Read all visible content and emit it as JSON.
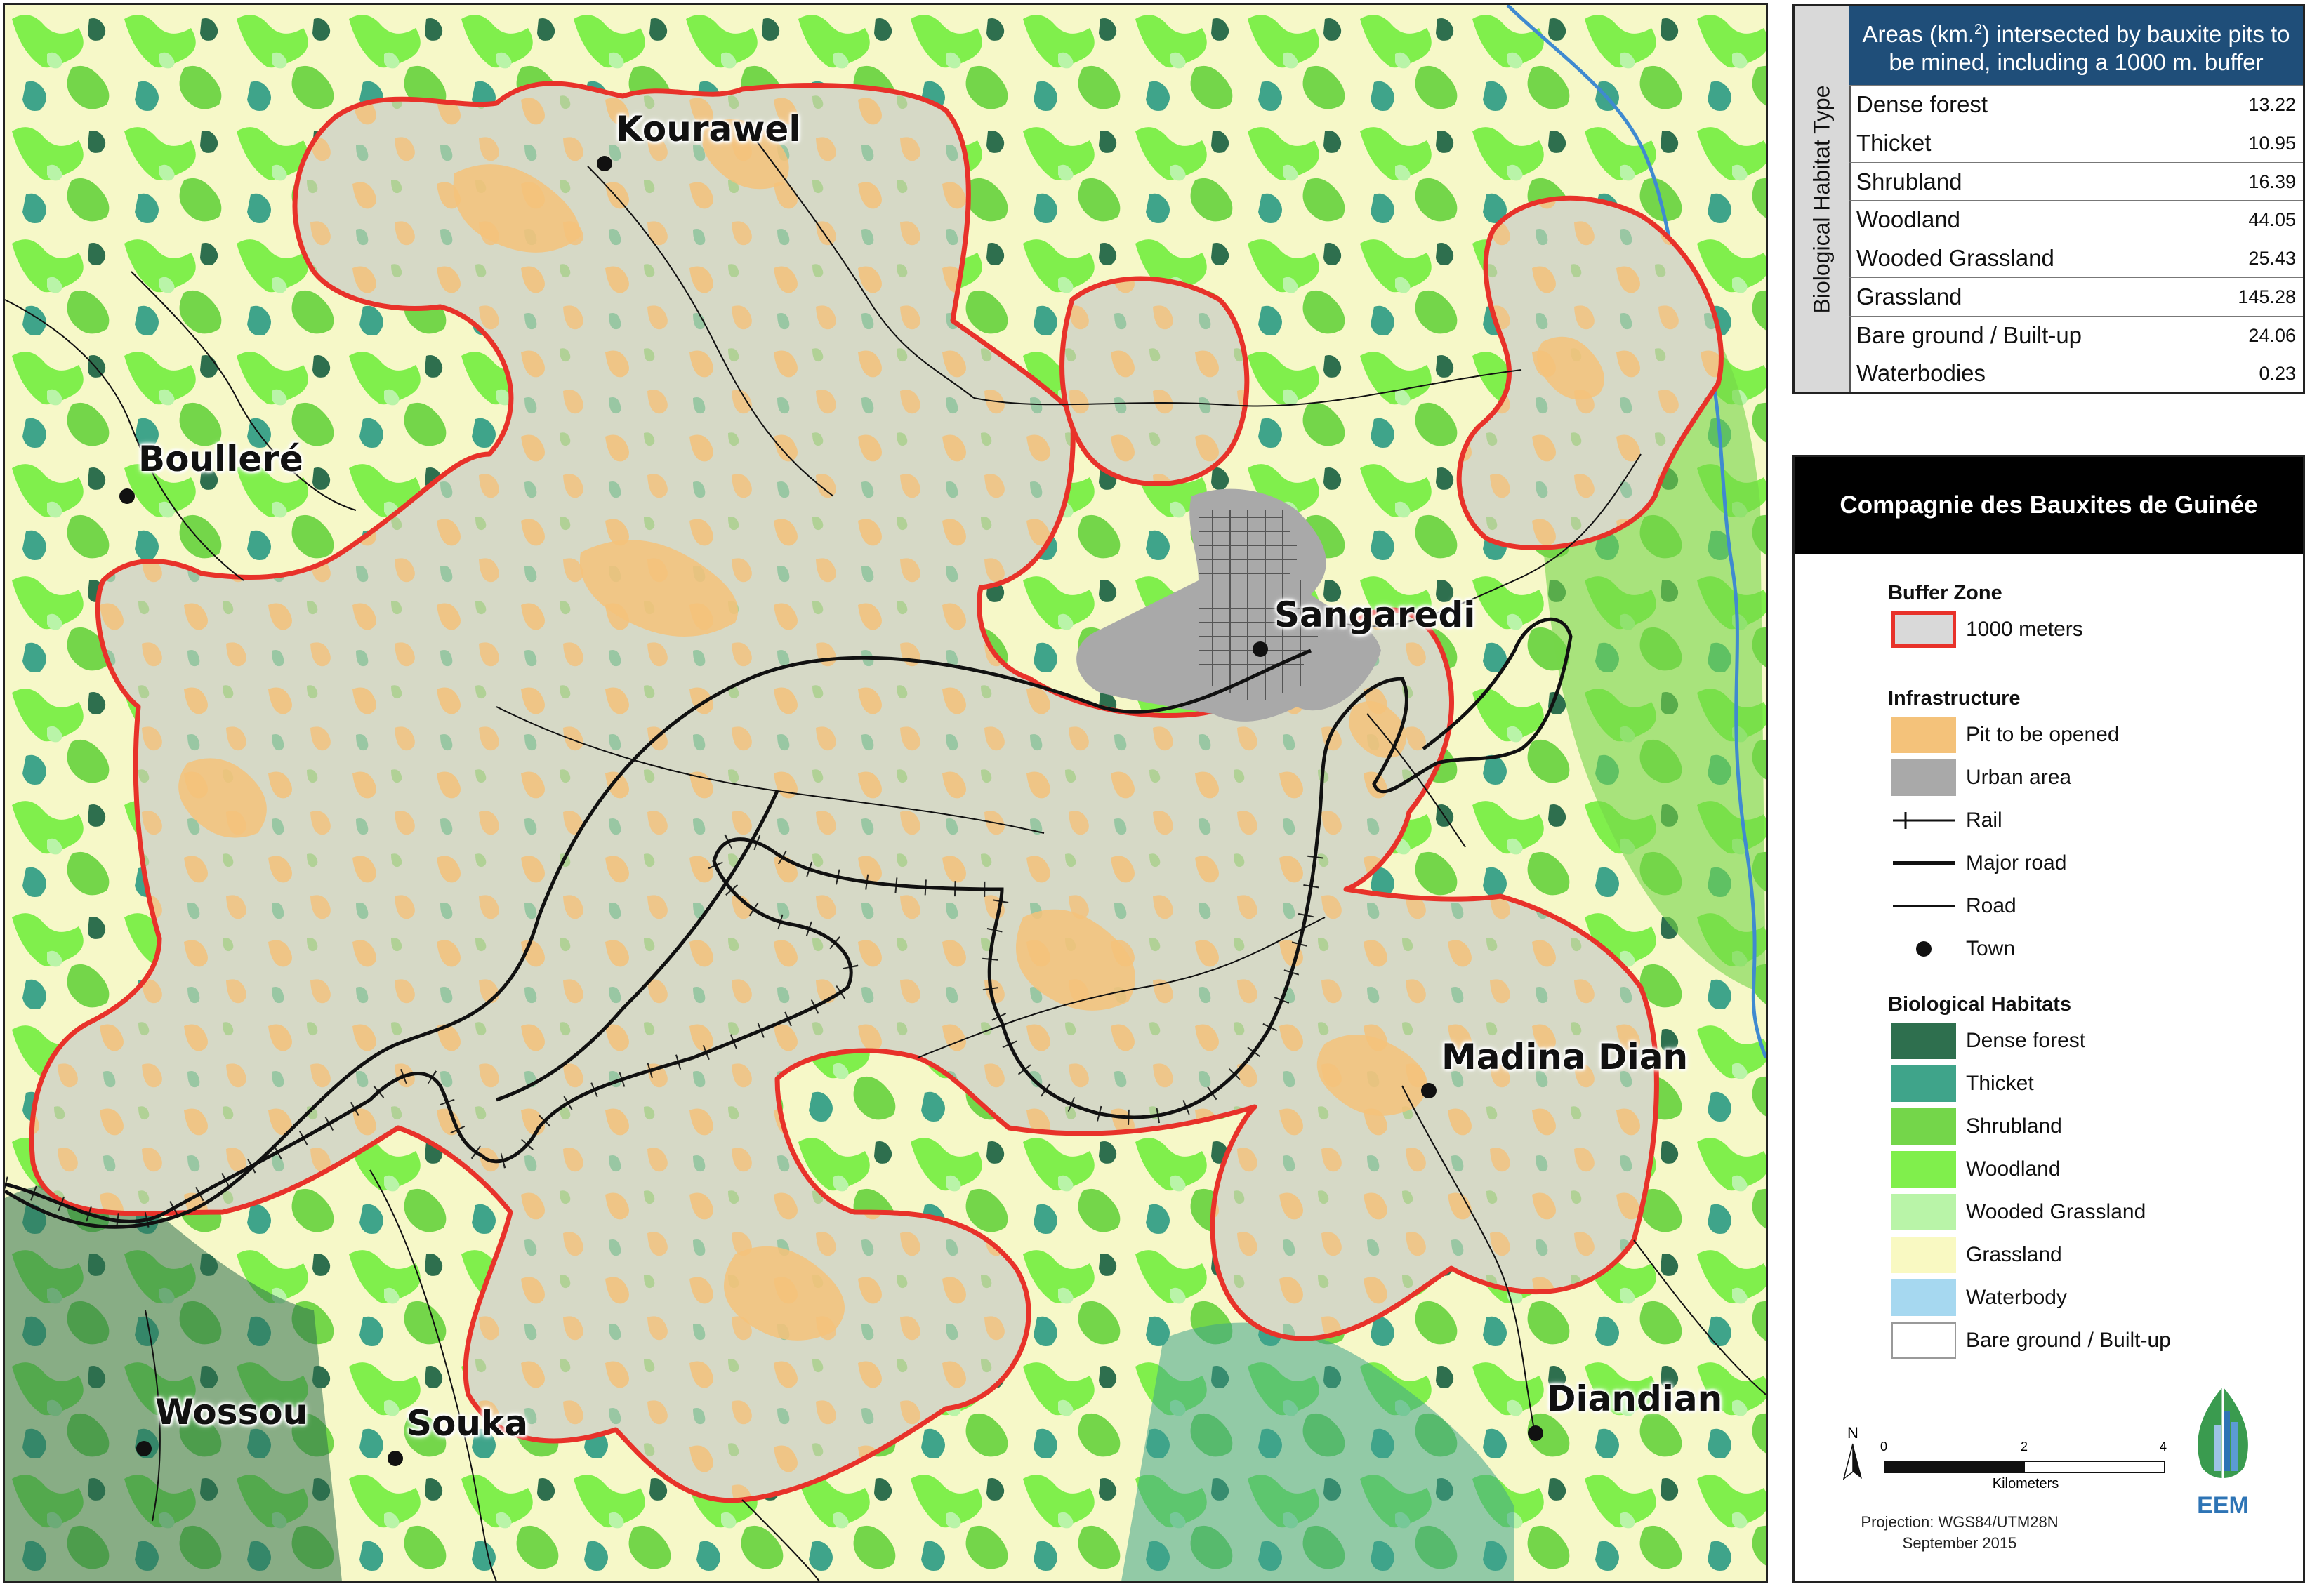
{
  "map": {
    "towns": [
      {
        "name": "Kourawel"
      },
      {
        "name": "Boulleré"
      },
      {
        "name": "Sangaredi"
      },
      {
        "name": "Madina Dian"
      },
      {
        "name": "Wossou"
      },
      {
        "name": "Souka"
      },
      {
        "name": "Diandian"
      }
    ],
    "colors": {
      "buffer_outline": "#e8322a",
      "buffer_fill": "#d8d8c8",
      "pit": "#f4c27a",
      "urban": "#a9a9a9",
      "dense_forest": "#2e6f4e",
      "thicket": "#3fa48a",
      "shrubland": "#74d64a",
      "woodland": "#80ef4c",
      "wooded_grassland": "#b9f4a8",
      "grassland": "#f9f9c2",
      "waterbody": "#a6d8f0",
      "bare": "#ffffff"
    }
  },
  "table": {
    "side_label": "Biological Habitat Type",
    "header_line1": "Areas (km.",
    "header_sup": "2",
    "header_line2": ") intersected by bauxite pits to be mined, including a 1000 m. buffer",
    "rows": [
      {
        "name": "Dense forest",
        "value": "13.22"
      },
      {
        "name": "Thicket",
        "value": "10.95"
      },
      {
        "name": "Shrubland",
        "value": "16.39"
      },
      {
        "name": "Woodland",
        "value": "44.05"
      },
      {
        "name": "Wooded Grassland",
        "value": "25.43"
      },
      {
        "name": "Grassland",
        "value": "145.28"
      },
      {
        "name": "Bare ground / Built-up",
        "value": "24.06"
      },
      {
        "name": "Waterbodies",
        "value": "0.23"
      }
    ]
  },
  "legend": {
    "title": "Compagnie des Bauxites de Guinée",
    "buffer_zone": {
      "heading": "Buffer Zone",
      "label": "1000 meters"
    },
    "infrastructure": {
      "heading": "Infrastructure",
      "pit": "Pit to be opened",
      "urban": "Urban area",
      "rail": "Rail",
      "major_road": "Major road",
      "road": "Road",
      "town": "Town"
    },
    "habitats": {
      "heading": "Biological Habitats",
      "items": [
        "Dense forest",
        "Thicket",
        "Shrubland",
        "Woodland",
        "Wooded Grassland",
        "Grassland",
        "Waterbody",
        "Bare ground / Built-up"
      ]
    },
    "north": "N",
    "scale": {
      "ticks": [
        "0",
        "2",
        "4"
      ],
      "unit": "Kilometers"
    },
    "projection": "Projection: WGS84/UTM28N",
    "date": "September 2015",
    "logo_text": "EEM"
  }
}
